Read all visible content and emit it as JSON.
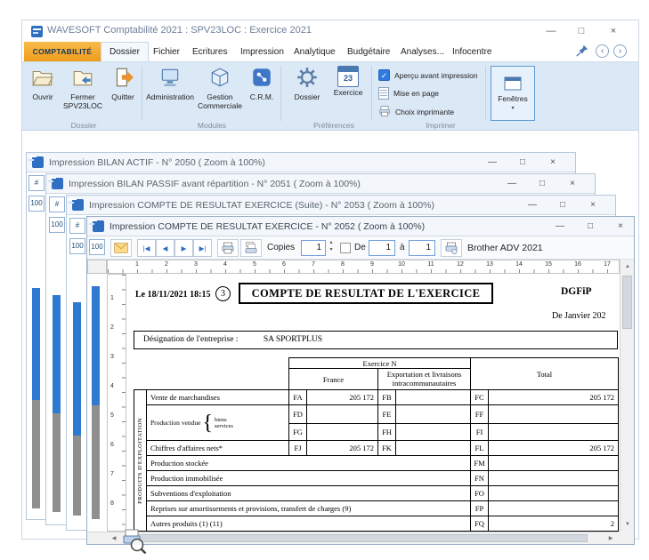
{
  "app": {
    "title": "WAVESOFT Comptabilité 2021 : SPV23LOC : Exercice 2021"
  },
  "window_controls": {
    "minimize": "—",
    "maximize": "□",
    "close": "×"
  },
  "glyphs": {
    "nav_first": "|◀",
    "nav_prev": "◀",
    "nav_next": "▶",
    "nav_last": "▶|",
    "scroll_up": "▲",
    "scroll_down": "▼",
    "scroll_left": "◀",
    "scroll_right": "▶",
    "dropdown": "▾",
    "spin_up": "▴",
    "spin_down": "▾",
    "check": "✓",
    "hash": "#",
    "nav_back": "‹",
    "nav_forward": "›"
  },
  "ribbon": {
    "tabs": [
      {
        "label": "COMPTABILITÉ"
      },
      {
        "label": "Dossier"
      },
      {
        "label": "Fichier"
      },
      {
        "label": "Ecritures"
      },
      {
        "label": "Impression"
      },
      {
        "label": "Analytique"
      },
      {
        "label": "Budgétaire"
      },
      {
        "label": "Analyses..."
      },
      {
        "label": "Infocentre"
      }
    ],
    "buttons": {
      "ouvrir": "Ouvrir",
      "fermer": "Fermer SPV23LOC",
      "quitter": "Quitter",
      "administration": "Administration",
      "gestion_commerciale": "Gestion Commerciale",
      "crm": "C.R.M.",
      "dossier": "Dossier",
      "exercice": "Exercice",
      "exercice_day": "23",
      "apercu": "Aperçu avant impression",
      "mise_en_page": "Mise en page",
      "choix_imprimante": "Choix imprimante",
      "fenetres": "Fenêtres"
    },
    "groups": {
      "dossier": "Dossier",
      "modules": "Modules",
      "preferences": "Préférences",
      "imprimer": "Imprimer"
    }
  },
  "windows": {
    "bilan_actif": "Impression BILAN ACTIF - N° 2050 ( Zoom à 100%)",
    "bilan_passif": "Impression BILAN PASSIF avant répartition - N° 2051 ( Zoom à 100%)",
    "resultat_suite": "Impression COMPTE DE RESULTAT EXERCICE (Suite) - N° 2053 ( Zoom à 100%)",
    "resultat": "Impression COMPTE DE RESULTAT EXERCICE - N° 2052 ( Zoom à 100%)"
  },
  "preview_toolbar": {
    "zoom": "100",
    "copies_label": "Copies",
    "copies_value": "1",
    "de_label": "De",
    "from_value": "1",
    "a_label": "à",
    "to_value": "1",
    "printer_name": "Brother ADV 2021"
  },
  "rulers": {
    "horizontal": [
      "1",
      "2",
      "3",
      "4",
      "5",
      "6",
      "7",
      "8",
      "9",
      "10",
      "11",
      "12",
      "13",
      "14",
      "15",
      "16",
      "17"
    ],
    "vertical": [
      "1",
      "2",
      "3",
      "4",
      "5",
      "6",
      "7",
      "8"
    ]
  },
  "document": {
    "date_line": "Le 18/11/2021 18:15",
    "page_number": "3",
    "title": "COMPTE DE RESULTAT DE L'EXERCICE",
    "agency": "DGFiP",
    "period": "De Janvier 202",
    "designation_label": "Désignation de l'entreprise :",
    "designation_value": "SA SPORTPLUS",
    "table": {
      "exercice_n": "Exercice N",
      "france": "France",
      "exportation": "Exportation et livraisons intracommunautaires",
      "total": "Total",
      "side_label": "PRODUITS D'EXPLOITATION",
      "brace": "{",
      "rows": {
        "ventes": {
          "label": "Vente de marchandises",
          "c1": "FA",
          "v1": "205 172",
          "c2": "FB",
          "v2": "",
          "c3": "FC",
          "v3": "205 172"
        },
        "production_vendue": "Production vendue",
        "biens": {
          "name": "biens",
          "c1": "FD",
          "v1": "",
          "c2": "FE",
          "v2": "",
          "c3": "FF",
          "v3": ""
        },
        "services": {
          "name": "services",
          "c1": "FG",
          "v1": "",
          "c2": "FH",
          "v2": "",
          "c3": "FI",
          "v3": ""
        },
        "ca_nets": {
          "label": "Chiffres d'affaires nets*",
          "c1": "FJ",
          "v1": "205 172",
          "c2": "FK",
          "v2": "",
          "c3": "FL",
          "v3": "205 172"
        },
        "prod_stockee": {
          "label": "Production stockée",
          "c3": "FM",
          "v3": ""
        },
        "prod_immobilisee": {
          "label": "Production immobilisée",
          "c3": "FN",
          "v3": ""
        },
        "subventions": {
          "label": "Subventions d'exploitation",
          "c3": "FO",
          "v3": ""
        },
        "reprises": {
          "label": "Reprises sur amortissements et provisions, transfert de charges (9)",
          "c3": "FP",
          "v3": ""
        },
        "autres_produits": {
          "label": "Autres produits (1) (11)",
          "c3": "FQ",
          "v3": "2"
        }
      }
    }
  }
}
